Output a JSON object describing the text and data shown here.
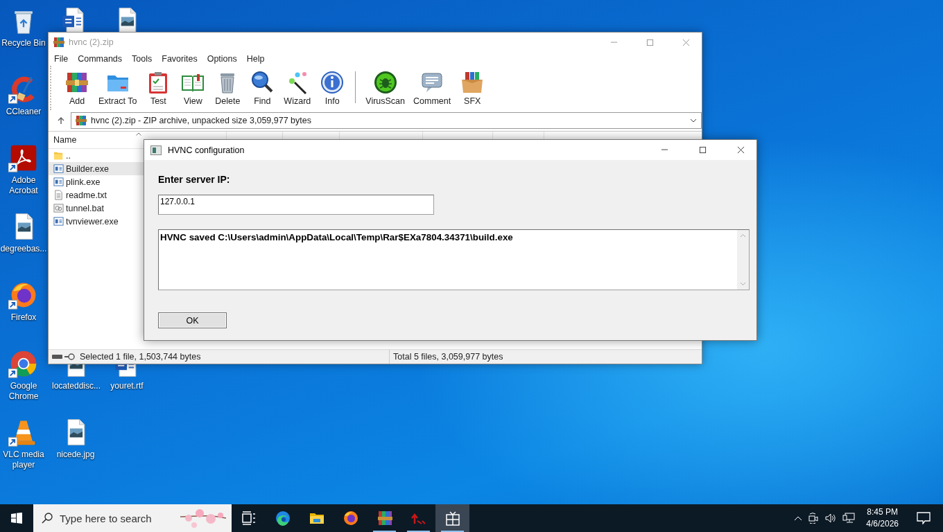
{
  "desktop": {
    "icons": [
      {
        "kind": "recycle",
        "label": "Recycle Bin",
        "shortcut": false
      },
      {
        "kind": "word",
        "shortcut": false
      },
      {
        "kind": "image",
        "shortcut": false
      },
      {
        "kind": "ccleaner",
        "label": "CCleaner",
        "shortcut": true
      },
      {
        "kind": "acrobat",
        "label": "Adobe Acrobat",
        "shortcut": true
      },
      {
        "kind": "image",
        "label": "degreebas...",
        "shortcut": false
      },
      {
        "kind": "firefox",
        "label": "Firefox",
        "shortcut": true
      },
      {
        "kind": "chrome",
        "label": "Google Chrome",
        "shortcut": true
      },
      {
        "kind": "image",
        "label": "locateddisc...",
        "shortcut": false
      },
      {
        "kind": "word",
        "label": "youret.rtf",
        "shortcut": false
      },
      {
        "kind": "vlc",
        "label": "VLC media player",
        "shortcut": true
      },
      {
        "kind": "image",
        "label": "nicede.jpg",
        "shortcut": false
      }
    ]
  },
  "archive_window": {
    "title": "hvnc (2).zip",
    "menu": [
      "File",
      "Commands",
      "Tools",
      "Favorites",
      "Options",
      "Help"
    ],
    "toolbar_groups": [
      {
        "buttons": [
          {
            "kind": "add",
            "label": "Add"
          },
          {
            "kind": "extract",
            "label": "Extract To"
          },
          {
            "kind": "test",
            "label": "Test"
          },
          {
            "kind": "view",
            "label": "View"
          },
          {
            "kind": "delete",
            "label": "Delete"
          },
          {
            "kind": "find",
            "label": "Find"
          },
          {
            "kind": "wizard",
            "label": "Wizard"
          },
          {
            "kind": "info",
            "label": "Info"
          }
        ]
      },
      {
        "buttons": [
          {
            "kind": "virusscan",
            "label": "VirusScan"
          },
          {
            "kind": "comment",
            "label": "Comment"
          },
          {
            "kind": "sfx",
            "label": "SFX"
          }
        ]
      }
    ],
    "address": "hvnc (2).zip - ZIP archive, unpacked size 3,059,977 bytes",
    "columns": [
      "Name"
    ],
    "files": [
      {
        "kind": "folder",
        "name": "..",
        "selected": false
      },
      {
        "kind": "exe",
        "name": "Builder.exe",
        "selected": true
      },
      {
        "kind": "exe",
        "name": "plink.exe",
        "selected": false
      },
      {
        "kind": "text",
        "name": "readme.txt",
        "selected": false
      },
      {
        "kind": "bat",
        "name": "tunnel.bat",
        "selected": false
      },
      {
        "kind": "exe",
        "name": "tvnviewer.exe",
        "selected": false
      }
    ],
    "status_left": "Selected 1 file, 1,503,744 bytes",
    "status_right": "Total 5 files, 3,059,977 bytes"
  },
  "dialog": {
    "title": "HVNC configuration",
    "prompt": "Enter server IP:",
    "ip_value": "127.0.0.1",
    "log": "HVNC saved C:\\Users\\admin\\AppData\\Local\\Temp\\Rar$EXa7804.34371\\build.exe",
    "ok_button": "OK"
  },
  "taskbar": {
    "search_placeholder": "Type here to search",
    "apps": [
      {
        "kind": "taskview",
        "running": false,
        "active": false
      },
      {
        "kind": "edge",
        "running": false,
        "active": false
      },
      {
        "kind": "explorer",
        "running": false,
        "active": false
      },
      {
        "kind": "firefox",
        "running": false,
        "active": false
      },
      {
        "kind": "winrar",
        "running": true,
        "active": false
      },
      {
        "kind": "arrow",
        "running": true,
        "active": false
      },
      {
        "kind": "app",
        "running": true,
        "active": true
      }
    ],
    "time": "8:45 PM",
    "date": "4/6/2026"
  }
}
